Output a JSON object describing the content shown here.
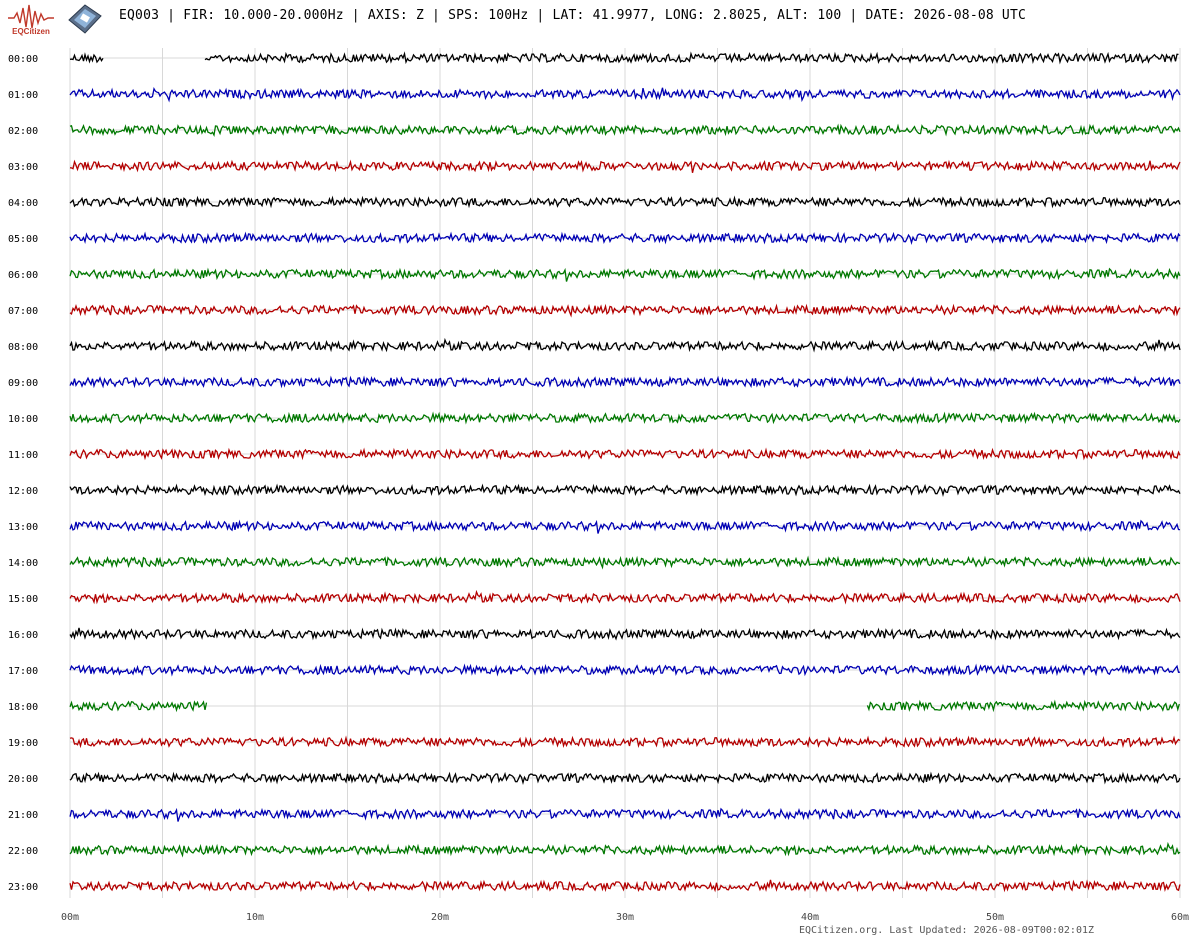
{
  "header": {
    "title": "EQ003 | FIR: 10.000-20.000Hz | AXIS: Z | SPS: 100Hz | LAT: 41.9977, LONG: 2.8025, ALT: 100 | DATE: 2026-08-08 UTC",
    "logo_text": "EQCitizen"
  },
  "footer": {
    "text": "EQCitizen.org. Last Updated: 2026-08-09T00:02:01Z"
  },
  "colors": {
    "black": "#000000",
    "blue": "#0000b4",
    "green": "#007800",
    "red": "#b40000",
    "grid": "#d8d8d8"
  },
  "chart_data": {
    "type": "line",
    "description_of_values": "helicorder: one trace per hour row, x axis minutes within the hour",
    "x_ticks": [
      "00m",
      "10m",
      "20m",
      "30m",
      "40m",
      "50m",
      "60m"
    ],
    "x_range": [
      0,
      60
    ],
    "rows": [
      {
        "label": "00:00",
        "color": "#000000",
        "segments": [
          [
            0,
            1.8
          ],
          [
            7.3,
            60
          ]
        ]
      },
      {
        "label": "01:00",
        "color": "#0000b4",
        "segments": [
          [
            0,
            60
          ]
        ]
      },
      {
        "label": "02:00",
        "color": "#007800",
        "segments": [
          [
            0,
            60
          ]
        ]
      },
      {
        "label": "03:00",
        "color": "#b40000",
        "segments": [
          [
            0,
            60
          ]
        ]
      },
      {
        "label": "04:00",
        "color": "#000000",
        "segments": [
          [
            0,
            60
          ]
        ]
      },
      {
        "label": "05:00",
        "color": "#0000b4",
        "segments": [
          [
            0,
            60
          ]
        ]
      },
      {
        "label": "06:00",
        "color": "#007800",
        "segments": [
          [
            0,
            60
          ]
        ]
      },
      {
        "label": "07:00",
        "color": "#b40000",
        "segments": [
          [
            0,
            60
          ]
        ]
      },
      {
        "label": "08:00",
        "color": "#000000",
        "segments": [
          [
            0,
            60
          ]
        ]
      },
      {
        "label": "09:00",
        "color": "#0000b4",
        "segments": [
          [
            0,
            60
          ]
        ]
      },
      {
        "label": "10:00",
        "color": "#007800",
        "segments": [
          [
            0,
            60
          ]
        ]
      },
      {
        "label": "11:00",
        "color": "#b40000",
        "segments": [
          [
            0,
            60
          ]
        ]
      },
      {
        "label": "12:00",
        "color": "#000000",
        "segments": [
          [
            0,
            60
          ]
        ]
      },
      {
        "label": "13:00",
        "color": "#0000b4",
        "segments": [
          [
            0,
            60
          ]
        ]
      },
      {
        "label": "14:00",
        "color": "#007800",
        "segments": [
          [
            0,
            60
          ]
        ]
      },
      {
        "label": "15:00",
        "color": "#b40000",
        "segments": [
          [
            0,
            60
          ]
        ]
      },
      {
        "label": "16:00",
        "color": "#000000",
        "segments": [
          [
            0,
            60
          ]
        ]
      },
      {
        "label": "17:00",
        "color": "#0000b4",
        "segments": [
          [
            0,
            60
          ]
        ]
      },
      {
        "label": "18:00",
        "color": "#007800",
        "segments": [
          [
            0,
            7.4
          ],
          [
            43.1,
            60
          ]
        ]
      },
      {
        "label": "19:00",
        "color": "#b40000",
        "segments": [
          [
            0,
            60
          ]
        ]
      },
      {
        "label": "20:00",
        "color": "#000000",
        "segments": [
          [
            0,
            60
          ]
        ]
      },
      {
        "label": "21:00",
        "color": "#0000b4",
        "segments": [
          [
            0,
            60
          ]
        ]
      },
      {
        "label": "22:00",
        "color": "#007800",
        "segments": [
          [
            0,
            60
          ]
        ]
      },
      {
        "label": "23:00",
        "color": "#b40000",
        "segments": [
          [
            0,
            60
          ]
        ]
      }
    ]
  }
}
